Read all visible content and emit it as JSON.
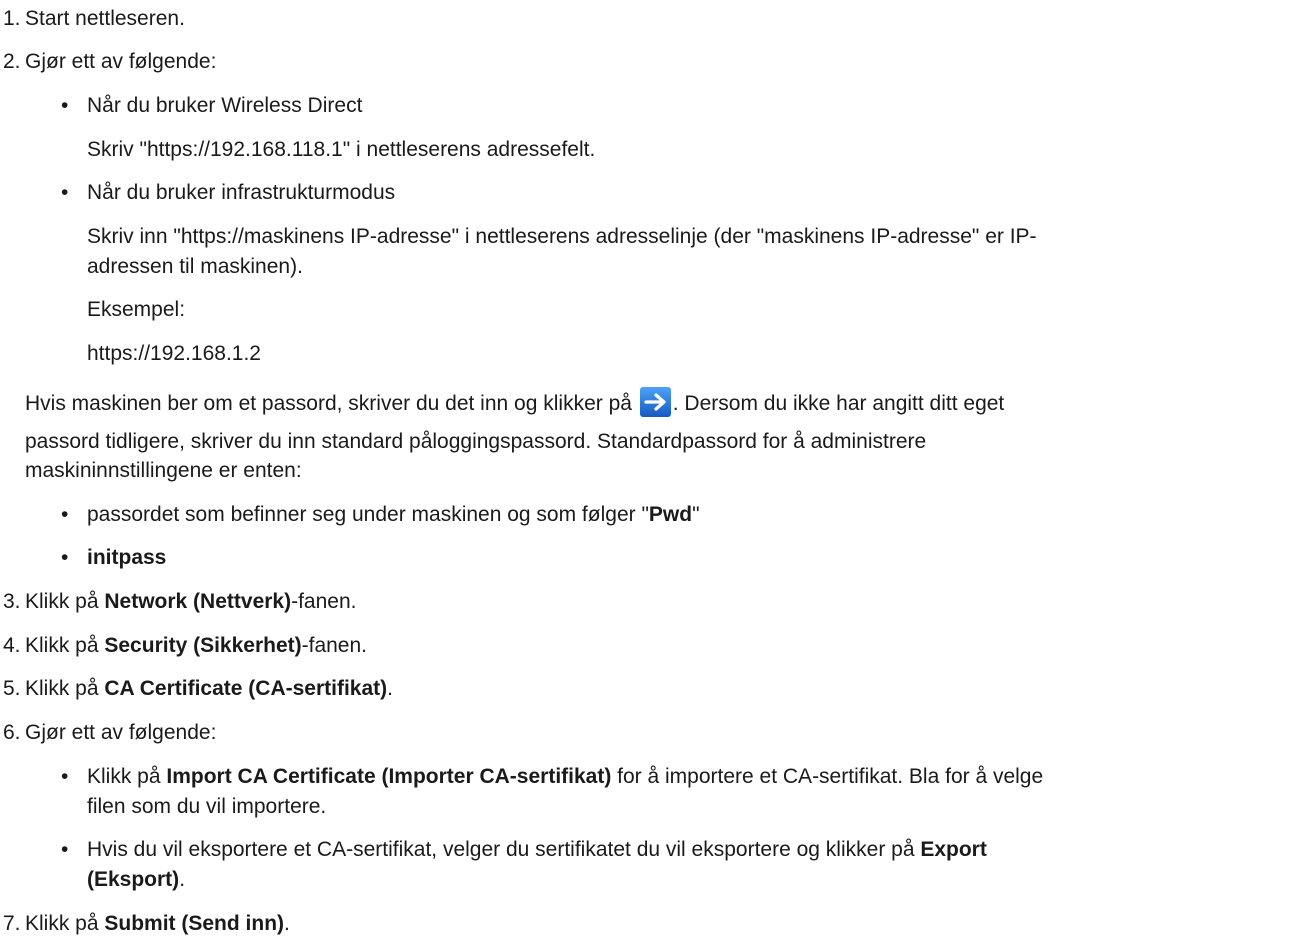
{
  "steps": [
    {
      "num": "1.",
      "text": "Start nettleseren."
    },
    {
      "num": "2.",
      "text": "Gjør ett av følgende:"
    },
    {
      "num": "3.",
      "pre": "Klikk på ",
      "bold": "Network (Nettverk)",
      "post": "-fanen."
    },
    {
      "num": "4.",
      "pre": "Klikk på ",
      "bold": "Security (Sikkerhet)",
      "post": "-fanen."
    },
    {
      "num": "5.",
      "pre": "Klikk på ",
      "bold": "CA Certificate (CA-sertifikat)",
      "post": "."
    },
    {
      "num": "6.",
      "text": "Gjør ett av følgende:"
    },
    {
      "num": "7.",
      "pre": "Klikk på ",
      "bold": "Submit (Send inn)",
      "post": "."
    }
  ],
  "step2": {
    "bullet_symbol": "•",
    "wireless": {
      "heading": "Når du bruker Wireless Direct",
      "detail": "Skriv \"https://192.168.118.1\" i nettleserens adressefelt."
    },
    "infra": {
      "heading": "Når du bruker infrastrukturmodus",
      "detail_line1": "Skriv inn \"https://maskinens IP-adresse\" i nettleserens adresselinje (der \"maskinens IP-adresse\" er IP-",
      "detail_line2": "adressen til maskinen).",
      "example_label": "Eksempel:",
      "example_value": "https://192.168.1.2"
    },
    "password": {
      "line1_pre": "Hvis maskinen ber om et passord, skriver du det inn og klikker på ",
      "line1_post": ". Dersom du ikke har angitt ditt eget",
      "line2": "passord tidligere, skriver du inn standard påloggingspassord. Standardpassord for å administrere",
      "line3": "maskininnstillingene er enten:",
      "icon": "arrow-right-icon",
      "icon_color": "#1e6fd9",
      "option1_pre": "passordet som befinner seg under maskinen og som følger \"",
      "option1_bold": "Pwd",
      "option1_post": "\"",
      "option2_bold": "initpass"
    }
  },
  "step6": {
    "import": {
      "pre": "Klikk på ",
      "bold": "Import CA Certificate (Importer CA-sertifikat)",
      "post_line1": " for å importere et CA-sertifikat. Bla for å velge",
      "line2": "filen som du vil importere."
    },
    "export": {
      "line1_pre": "Hvis du vil eksportere et CA-sertifikat, velger du sertifikatet du vil eksportere og klikker på ",
      "line1_bold": "Export",
      "line2_bold": "(Eksport)",
      "line2_post": "."
    }
  }
}
